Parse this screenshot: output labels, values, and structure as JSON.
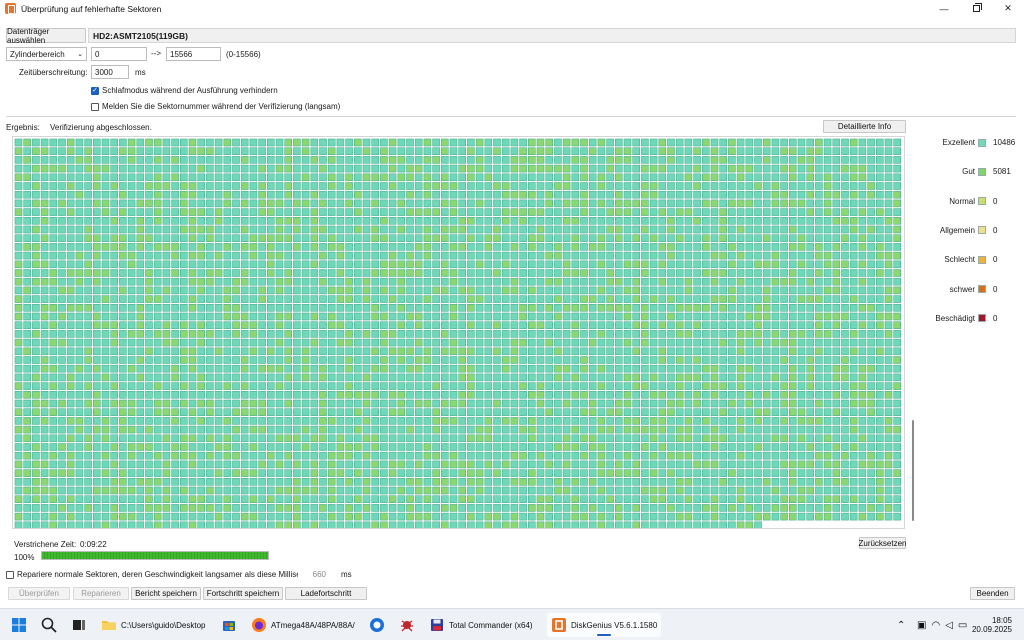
{
  "window": {
    "title": "Überprüfung auf fehlerhafte Sektoren",
    "minimize": "—",
    "close": "✕"
  },
  "top": {
    "select_disk_label": "Datenträger auswählen",
    "disk_name": "HD2:ASMT2105(119GB)",
    "range_type": "Zylinderbereich",
    "range_start": "0",
    "range_arrow": "-->",
    "range_end": "15566",
    "range_hint": "(0-15566)",
    "timeout_label": "Zeitüberschreitung:",
    "timeout_value": "3000",
    "timeout_unit": "ms",
    "sleep_label": "Schlafmodus während der Ausführung verhindern",
    "sleep_checked": true,
    "report_label": "Melden Sie die Sektornummer während der Verifizierung (langsam)",
    "report_checked": false
  },
  "result": {
    "label": "Ergebnis:",
    "value": "Verifizierung abgeschlossen.",
    "details_button": "Detaillierte Info"
  },
  "legend": [
    {
      "label": "Exzellent",
      "count": "10486",
      "color": "#6ed9b9"
    },
    {
      "label": "Gut",
      "count": "5081",
      "color": "#7fd46a"
    },
    {
      "label": "Normal",
      "count": "0",
      "color": "#c8e06a"
    },
    {
      "label": "Allgemein",
      "count": "0",
      "color": "#f1e08a"
    },
    {
      "label": "Schlecht",
      "count": "0",
      "color": "#f0b13a"
    },
    {
      "label": "schwer",
      "count": "0",
      "color": "#d97016"
    },
    {
      "label": "Beschädigt",
      "count": "0",
      "color": "#a3182a"
    }
  ],
  "grid": {
    "excellent_color": "#6ed9b9",
    "good_color": "#8ad86f",
    "border_color": "#4cae8f",
    "good_ratio": 0.3264
  },
  "status": {
    "elapsed_label": "Verstrichene Zeit:",
    "elapsed_value": "0:09:22",
    "progress_text": "100%",
    "progress_fraction": 1.0,
    "reset_button": "Zurücksetzen"
  },
  "repair": {
    "label": "Repariere normale Sektoren, deren Geschwindigkeit langsamer als diese Millisekunde ist:",
    "value": "660",
    "unit": "ms",
    "checked": false
  },
  "buttons": {
    "check": "Überprüfen",
    "repair": "Reparieren",
    "save_report": "Bericht speichern",
    "save_progress": "Fortschritt speichern",
    "load_progress": "Ladefortschritt",
    "exit": "Beenden"
  },
  "taskbar": {
    "explorer_label": "C:\\Users\\guido\\Desktop",
    "firefox_label": "ATmega48A/48PA/88A/",
    "tc_label": "Total Commander (x64)",
    "dg_label": "DiskGenius V5.6.1.1580",
    "time": "18:05",
    "date": "20.09.2025"
  }
}
